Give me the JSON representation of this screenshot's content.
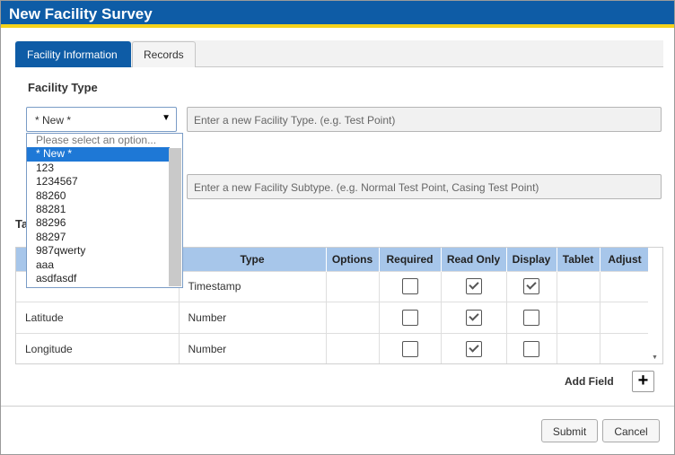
{
  "dialog": {
    "title": "New Facility Survey"
  },
  "tabs": [
    {
      "label": "Facility Information",
      "active": true
    },
    {
      "label": "Records",
      "active": false
    }
  ],
  "facility_type": {
    "section_label": "Facility Type",
    "select_value": "* New *",
    "type_placeholder": "Enter a new Facility Type. (e.g. Test Point)",
    "subtype_placeholder": "Enter a new Facility Subtype. (e.g. Normal Test Point, Casing Test Point)"
  },
  "dropdown": {
    "placeholder": "Please select an option...",
    "options": [
      "* New *",
      "123",
      "1234567",
      "88260",
      "88281",
      "88296",
      "88297",
      "987qwerty",
      "aaa",
      "asdfasdf"
    ],
    "selected": "* New *"
  },
  "table_section": {
    "heading": "Ta"
  },
  "grid": {
    "columns": [
      "",
      "Type",
      "Options",
      "Required",
      "Read Only",
      "Display",
      "Tablet",
      "Adjust"
    ],
    "rows": [
      {
        "name": "",
        "type": "Timestamp",
        "required": false,
        "read_only": true,
        "display": true
      },
      {
        "name": "Latitude",
        "type": "Number",
        "required": false,
        "read_only": true,
        "display": false
      },
      {
        "name": "Longitude",
        "type": "Number",
        "required": false,
        "read_only": true,
        "display": false
      }
    ]
  },
  "add_field": {
    "label": "Add Field",
    "icon": "plus-icon",
    "glyph": "+"
  },
  "footer": {
    "submit_label": "Submit",
    "cancel_label": "Cancel"
  },
  "colors": {
    "titlebar": "#0e5ca6",
    "accent_stripe": "#f5d21b",
    "header_row": "#a7c6ea",
    "selected_option": "#1e78d6"
  }
}
